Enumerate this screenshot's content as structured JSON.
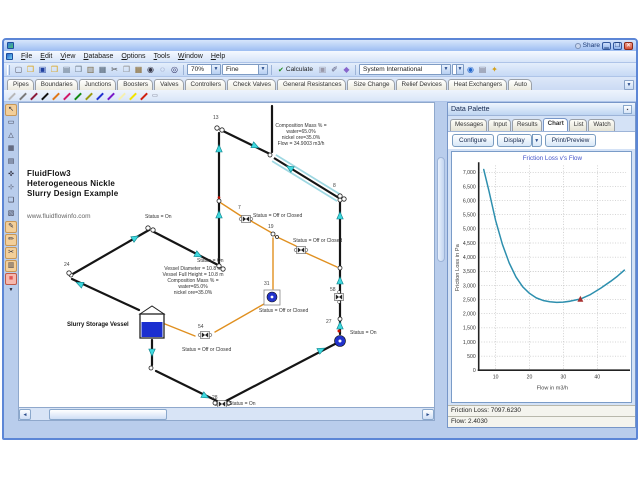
{
  "window": {
    "share_label": "Share"
  },
  "menu": {
    "items": [
      "File",
      "Edit",
      "View",
      "Database",
      "Options",
      "Tools",
      "Window",
      "Help"
    ]
  },
  "toolbar": {
    "icons_a": [
      {
        "name": "new-file-icon",
        "glyph": "▢",
        "color": "#556"
      },
      {
        "name": "open-file-icon",
        "glyph": "❒",
        "color": "#d8a010"
      },
      {
        "name": "save-icon",
        "glyph": "▣",
        "color": "#2040a0"
      },
      {
        "name": "folder-icon",
        "glyph": "❒",
        "color": "#d8a010"
      },
      {
        "name": "print-icon",
        "glyph": "▤",
        "color": "#607080"
      },
      {
        "name": "preview-icon",
        "glyph": "❐",
        "color": "#607080"
      },
      {
        "name": "export-icon",
        "glyph": "▥",
        "color": "#7a6a4a"
      },
      {
        "name": "report-icon",
        "glyph": "▦",
        "color": "#567"
      },
      {
        "name": "cut-icon",
        "glyph": "✂",
        "color": "#444"
      },
      {
        "name": "copy-icon",
        "glyph": "❐",
        "color": "#888"
      },
      {
        "name": "paste-icon",
        "glyph": "▦",
        "color": "#8a6a30"
      },
      {
        "name": "find-icon",
        "glyph": "◉",
        "color": "#334"
      },
      {
        "name": "zoom-out-icon",
        "glyph": "◌",
        "color": "#336"
      },
      {
        "name": "zoom-in-icon",
        "glyph": "◎",
        "color": "#336"
      }
    ],
    "zoom_value": "70%",
    "quality_value": "Fine",
    "calculate_label": "Calculate",
    "calc_check": "✔",
    "icons_b": [
      {
        "name": "stop-icon",
        "glyph": "▣",
        "color": "#99a"
      },
      {
        "name": "pencil-dropdown-icon",
        "glyph": "✐",
        "color": "#557"
      },
      {
        "name": "eraser-icon",
        "glyph": "◆",
        "color": "#8866cc"
      }
    ],
    "units_value": "System International",
    "icons_c": [
      {
        "name": "info-icon",
        "glyph": "◉",
        "color": "#2266cc"
      },
      {
        "name": "notes-icon",
        "glyph": "▤",
        "color": "#778"
      },
      {
        "name": "key-icon",
        "glyph": "✦",
        "color": "#d4a017"
      }
    ]
  },
  "tabs": {
    "items": [
      "Pipes",
      "Boundaries",
      "Junctions",
      "Boosters",
      "Valves",
      "Controllers",
      "Check Valves",
      "General Resistances",
      "Size Change",
      "Relief Devices",
      "Heat Exchangers",
      "Auto"
    ]
  },
  "pen_colors": [
    "#b8b8b8",
    "#7a7a7a",
    "#8b1a3a",
    "#111111",
    "#e07818",
    "#d01868",
    "#128a12",
    "#9a9a10",
    "#2030d0",
    "#7a18c8",
    "#f5f0b0",
    "#f2e400",
    "#d02010"
  ],
  "sidebar": {
    "icons": [
      {
        "name": "select-tool-icon",
        "glyph": "↖",
        "hl": true
      },
      {
        "name": "rectangle-tool-icon",
        "glyph": "▭",
        "hl": false
      },
      {
        "name": "polygon-tool-icon",
        "glyph": "△",
        "hl": false
      },
      {
        "name": "image-tool-icon",
        "glyph": "▦",
        "hl": false
      },
      {
        "name": "grid-tool-icon",
        "glyph": "▤",
        "hl": false
      },
      {
        "name": "move-tool-icon",
        "glyph": "✜",
        "hl": false
      },
      {
        "name": "target-tool-icon",
        "glyph": "⊹",
        "hl": false
      },
      {
        "name": "comment-tool-icon",
        "glyph": "❑",
        "hl": false
      },
      {
        "name": "layers-tool-icon",
        "glyph": "▧",
        "hl": false
      },
      {
        "name": "color-tool-icon",
        "glyph": "✎",
        "hl": true
      },
      {
        "name": "pen-tool-icon",
        "glyph": "✏",
        "hl": true
      },
      {
        "name": "scissors-tool-icon",
        "glyph": "✂",
        "hl": true
      },
      {
        "name": "chart-tool-icon",
        "glyph": "▥",
        "hl": true
      },
      {
        "name": "highlight-tool-icon",
        "glyph": "■",
        "hl": true,
        "red": true
      }
    ]
  },
  "canvas": {
    "title_lines": [
      "FluidFlow3",
      "Heterogeneous Nickle",
      "Slurry Design Example"
    ],
    "website": "www.fluidflowinfo.com",
    "vessel_label": "Slurry Storage Vessel",
    "top_annotation": [
      "Composition Mass % =",
      "water=65.0%",
      "nickel ore=35.0%",
      "Flow = 34.9003 m3/h"
    ],
    "vessel_annotation": [
      "Vessel Diameter = 10.8 m",
      "Vessel Full Height = 10.8 m",
      "Composition Mass % =",
      "water=65.0%",
      "nickel ore=35.0%"
    ],
    "status_on": "Status = On",
    "status_off": "Status = Off or Closed",
    "node_numbers": {
      "n13": "13",
      "n7": "7",
      "n19": "19",
      "n31": "31",
      "n8": "8",
      "n58": "58",
      "n27": "27",
      "n24": "24",
      "n54": "54",
      "n28": "28"
    }
  },
  "palette": {
    "title": "Data Palette",
    "tabs": [
      "Messages",
      "Input",
      "Results",
      "Chart",
      "List",
      "Watch"
    ],
    "active_tab": "Chart",
    "configure_label": "Configure",
    "display_label": "Display",
    "print_label": "Print/Preview",
    "status_lines": [
      "Friction Loss: 7097.6230",
      "Flow: 2.4030"
    ]
  },
  "chart_data": {
    "type": "line",
    "title": "Friction Loss v's Flow",
    "xlabel": "Flow in m3/h",
    "ylabel": "Friction Loss in Pa",
    "xlim": [
      5,
      48.5
    ],
    "ylim": [
      0,
      7250
    ],
    "x_ticks": [
      10,
      20,
      30,
      40
    ],
    "y_ticks": [
      0,
      500,
      1000,
      1500,
      2000,
      2500,
      3000,
      3500,
      4000,
      4500,
      5000,
      5500,
      6000,
      6500,
      7000
    ],
    "grid": "dotted",
    "legend": "none",
    "series": [
      {
        "name": "Friction Loss",
        "color": "#2d8fae",
        "x": [
          6.5,
          8,
          10,
          12,
          14,
          16,
          18,
          20,
          22,
          24,
          26,
          28,
          30,
          32,
          35,
          38,
          41,
          44,
          46,
          48
        ],
        "y": [
          7100,
          6350,
          5300,
          4450,
          3800,
          3300,
          2950,
          2720,
          2560,
          2470,
          2420,
          2400,
          2410,
          2445,
          2520,
          2680,
          2900,
          3150,
          3330,
          3540
        ]
      }
    ],
    "marker": {
      "x": 35,
      "y": 2520,
      "color": "#a83030"
    }
  }
}
